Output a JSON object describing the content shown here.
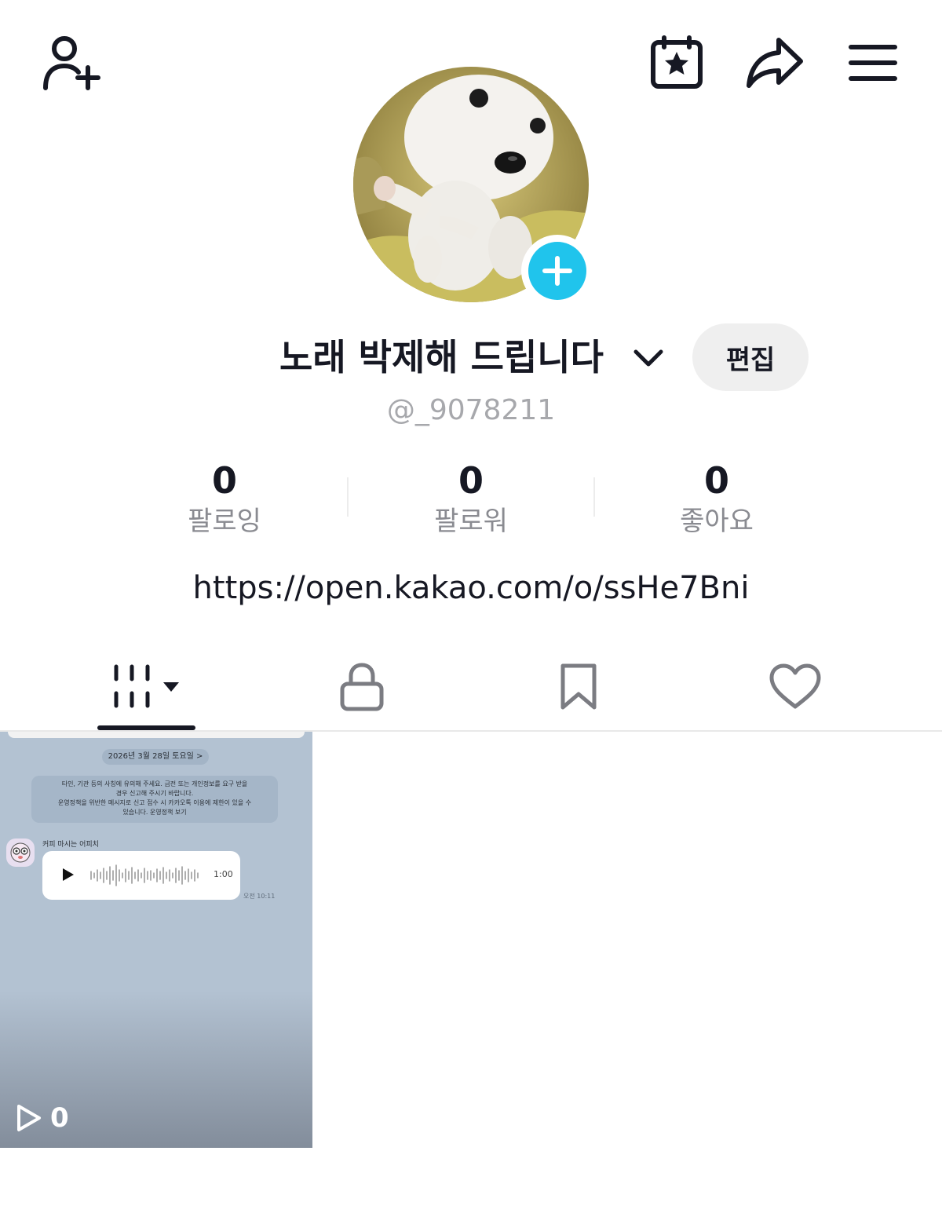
{
  "header": {
    "add_friend_icon": "person-plus-icon",
    "calendar_icon": "calendar-star-icon",
    "share_icon": "share-arrow-icon",
    "menu_icon": "hamburger-menu-icon"
  },
  "profile": {
    "display_name": "노래 박제해 드립니다",
    "username": "@_9078211",
    "edit_label": "편집",
    "link": "https://open.kakao.com/o/ssHe7Bni",
    "accent_color": "#20c4ec"
  },
  "stats": [
    {
      "value": "0",
      "label": "팔로잉"
    },
    {
      "value": "0",
      "label": "팔로워"
    },
    {
      "value": "0",
      "label": "좋아요"
    }
  ],
  "tabs": [
    {
      "name": "videos",
      "icon": "grid-bars-icon",
      "active": true
    },
    {
      "name": "private",
      "icon": "lock-icon",
      "active": false
    },
    {
      "name": "saved",
      "icon": "bookmark-icon",
      "active": false
    },
    {
      "name": "liked",
      "icon": "heart-icon",
      "active": false
    }
  ],
  "videos": [
    {
      "view_count": "0",
      "thumbnail": {
        "date": "2026년 3월 28일 토요일 >",
        "notice_line1": "타인, 기관 등의 사칭에 유의해 주세요. 금전 또는 개인정보를 요구 받을",
        "notice_line2": "경우 신고해 주시기 바랍니다.",
        "notice_line3": "운영정책을 위반한 메시지로 신고 접수 시 카카오톡 이용에 제한이 있을 수",
        "notice_line4": "있습니다. 운영정책 보기",
        "sender": "커피 마시는 어피치",
        "voice_duration": "1:00",
        "message_time": "오전 10:11"
      }
    }
  ]
}
